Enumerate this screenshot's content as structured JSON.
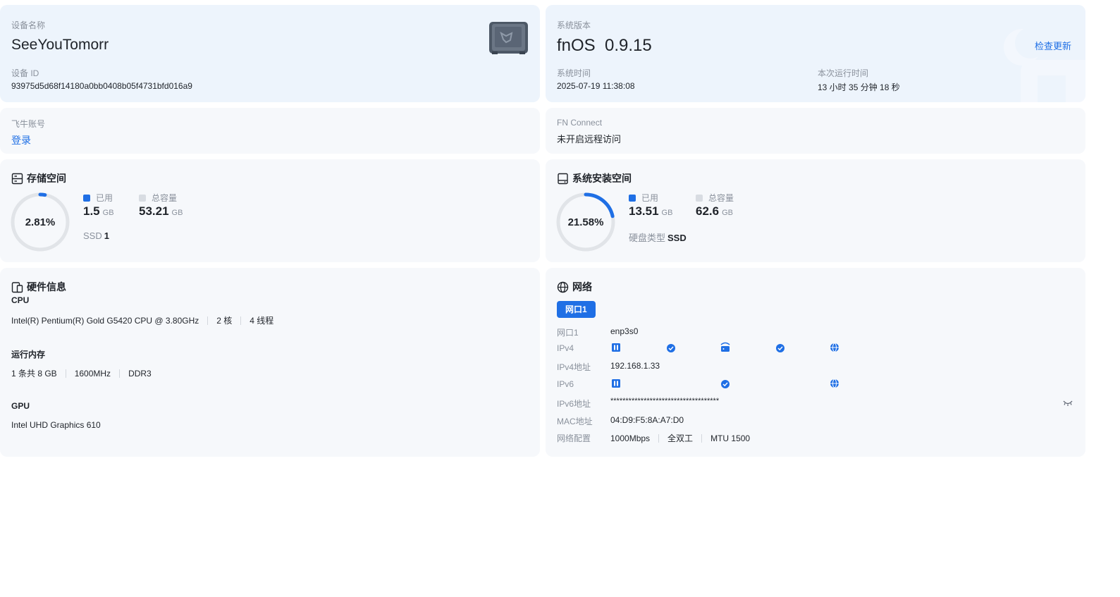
{
  "device": {
    "name_label": "设备名称",
    "name": "SeeYouTomorr",
    "id_label": "设备 ID",
    "id": "93975d5d68f14180a0bb0408b05f4731bfd016a9"
  },
  "system": {
    "version_label": "系统版本",
    "version_os": "fnOS",
    "version_number": "0.9.15",
    "check_update": "检查更新",
    "time_label": "系统时间",
    "time": "2025-07-19 11:38:08",
    "uptime_label": "本次运行时间",
    "uptime": "13 小时 35 分钟 18 秒"
  },
  "account": {
    "label": "飞牛账号",
    "login": "登录"
  },
  "connect": {
    "label": "FN Connect",
    "status": "未开启远程访问"
  },
  "storage": {
    "title": "存储空间",
    "percent": "2.81%",
    "percent_value": 2.81,
    "used_label": "已用",
    "used": "1.5",
    "used_unit": "GB",
    "total_label": "总容量",
    "total": "53.21",
    "total_unit": "GB",
    "extra_key": "SSD",
    "extra_val": "1"
  },
  "sys_storage": {
    "title": "系统安装空间",
    "percent": "21.58%",
    "percent_value": 21.58,
    "used_label": "已用",
    "used": "13.51",
    "used_unit": "GB",
    "total_label": "总容量",
    "total": "62.6",
    "total_unit": "GB",
    "extra_key": "硬盘类型",
    "extra_val": "SSD"
  },
  "hardware": {
    "title": "硬件信息",
    "cpu_label": "CPU",
    "cpu_model": "Intel(R) Pentium(R) Gold G5420 CPU @ 3.80GHz",
    "cpu_cores": "2 核",
    "cpu_threads": "4 线程",
    "mem_label": "运行内存",
    "mem_modules": "1 条共 8 GB",
    "mem_speed": "1600MHz",
    "mem_type": "DDR3",
    "gpu_label": "GPU",
    "gpu_model": "Intel UHD Graphics 610"
  },
  "network": {
    "title": "网络",
    "tab": "网口1",
    "port_label": "网口1",
    "port": "enp3s0",
    "ipv4_label": "IPv4",
    "ipv4_addr_label": "IPv4地址",
    "ipv4_addr": "192.168.1.33",
    "ipv6_label": "IPv6",
    "ipv6_addr_label": "IPv6地址",
    "ipv6_addr": "************************************",
    "mac_label": "MAC地址",
    "mac": "04:D9:F5:8A:A7:D0",
    "config_label": "网络配置",
    "speed": "1000Mbps",
    "duplex": "全双工",
    "mtu": "MTU 1500"
  },
  "colors": {
    "accent": "#1f6fe5",
    "card_blue": "#edf4fc",
    "card_grey": "#f6f8fb",
    "ring_track": "#e1e4e8",
    "total_square": "#d8dce2"
  },
  "icons": {
    "device": "nas-device-icon",
    "storage": "storage-icon",
    "sys_storage": "disk-icon",
    "hardware": "hardware-icon",
    "network": "globe-icon",
    "hide_ipv6": "eye-closed-icon"
  }
}
